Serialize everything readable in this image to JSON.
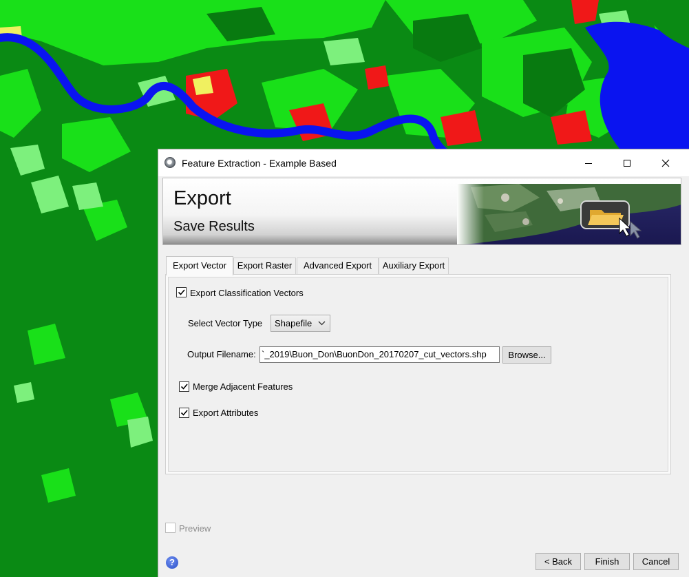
{
  "window": {
    "title": "Feature Extraction - Example Based",
    "icon": "app-globe-icon",
    "controls": [
      "minimize-icon",
      "maximize-icon",
      "close-icon"
    ]
  },
  "header": {
    "title": "Export",
    "subtitle": "Save Results",
    "image": "satellite-folder-banner"
  },
  "tabs": [
    {
      "label": "Export Vector",
      "active": true
    },
    {
      "label": "Export Raster",
      "active": false
    },
    {
      "label": "Advanced Export",
      "active": false
    },
    {
      "label": "Auxiliary Export",
      "active": false
    }
  ],
  "export_vector": {
    "export_classification_vectors": {
      "label": "Export Classification Vectors",
      "checked": true
    },
    "vector_type": {
      "label": "Select Vector Type",
      "value": "Shapefile"
    },
    "output_filename": {
      "label": "Output Filename:",
      "value": "`_2019\\Buon_Don\\BuonDon_20170207_cut_vectors.shp",
      "browse_label": "Browse..."
    },
    "merge_adjacent_features": {
      "label": "Merge Adjacent Features",
      "checked": true
    },
    "export_attributes": {
      "label": "Export Attributes",
      "checked": true
    }
  },
  "footer": {
    "preview": {
      "label": "Preview",
      "checked": false,
      "enabled": false
    },
    "help_icon": "help-icon",
    "back_label": "< Back",
    "finish_label": "Finish",
    "cancel_label": "Cancel"
  },
  "colors": {
    "map_forest": "#0a8a14",
    "map_light_vegetation": "#19e019",
    "map_pale_vegetation": "#7df07d",
    "map_water": "#0a14f0",
    "map_urban": "#f01818",
    "map_bare": "#f0f060"
  }
}
